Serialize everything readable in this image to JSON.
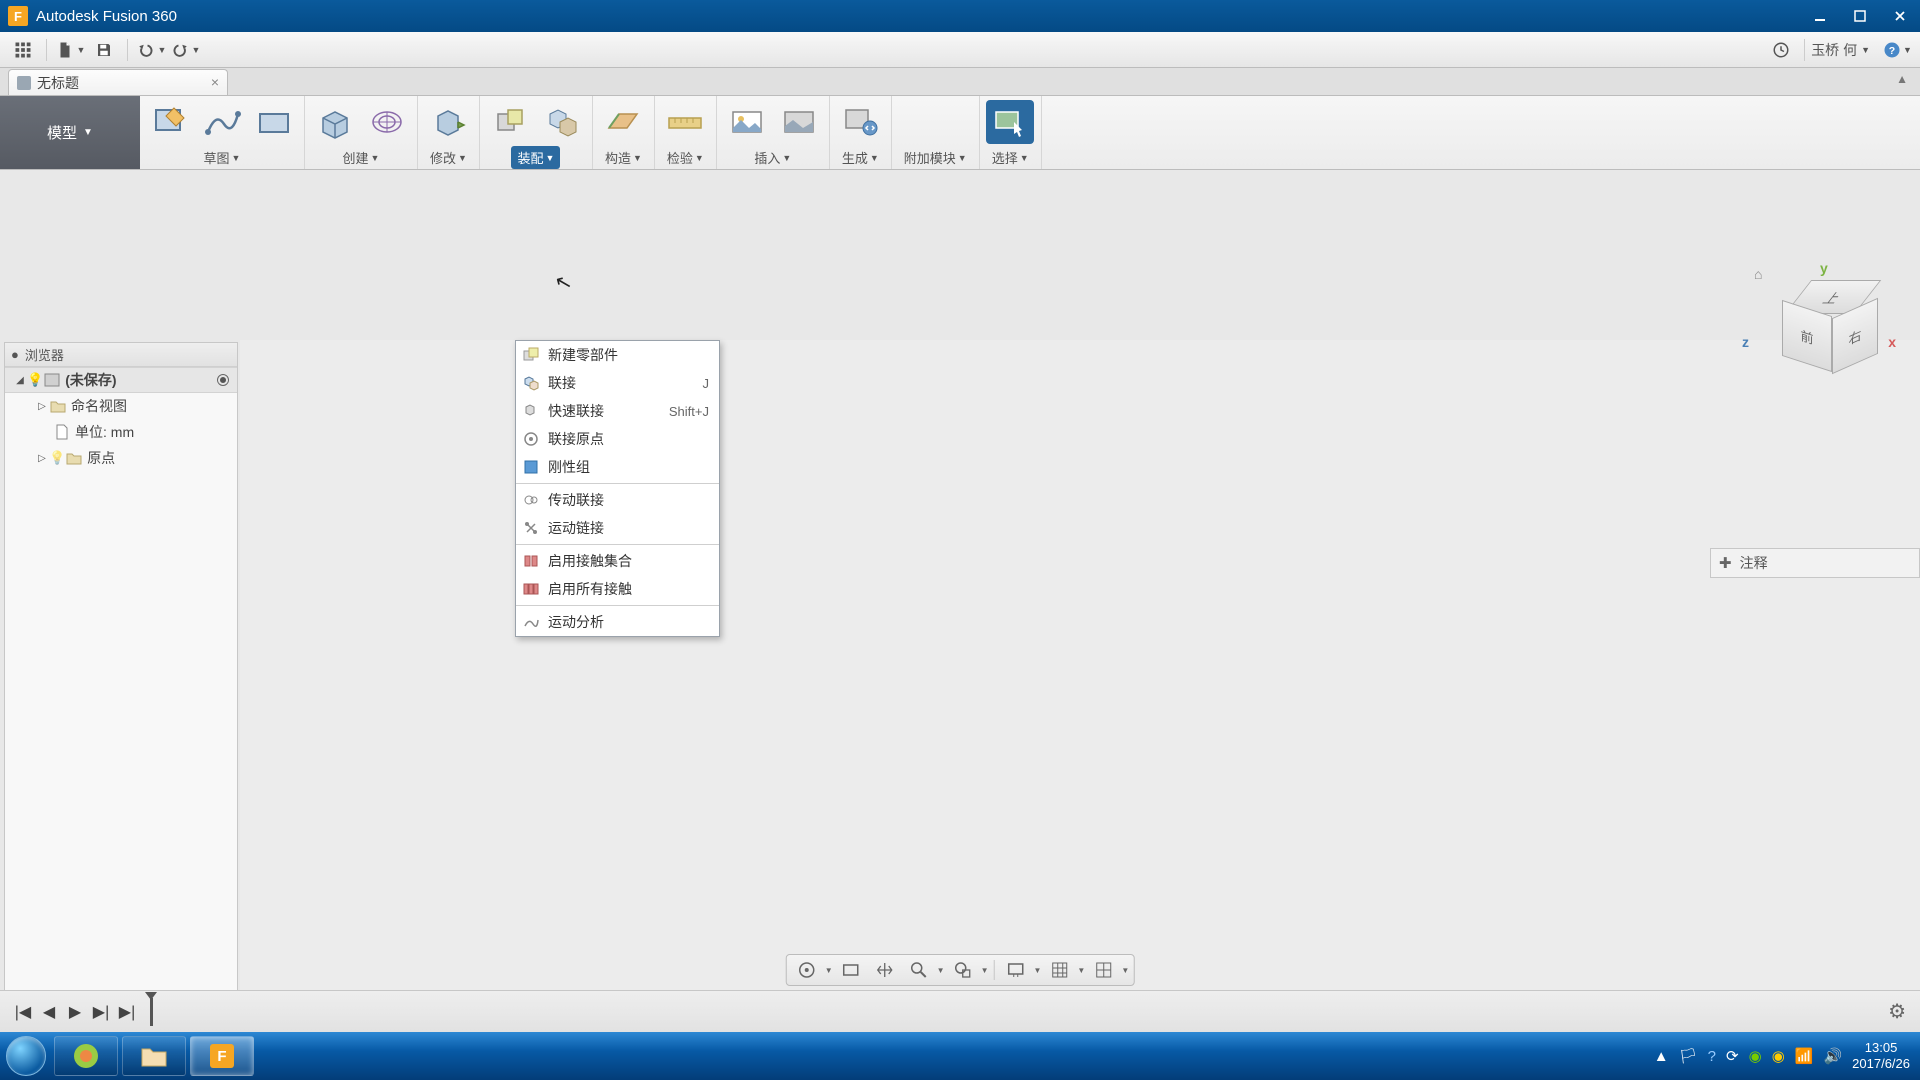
{
  "title": "Autodesk Fusion 360",
  "appInitial": "F",
  "user": "玉桥 何",
  "docTab": "无标题",
  "modeLabel": "模型",
  "ribbonGroups": [
    {
      "label": "草图"
    },
    {
      "label": "创建"
    },
    {
      "label": "修改"
    },
    {
      "label": "装配",
      "active": true
    },
    {
      "label": "构造"
    },
    {
      "label": "检验"
    },
    {
      "label": "插入"
    },
    {
      "label": "生成"
    },
    {
      "label": "附加模块"
    },
    {
      "label": "选择",
      "selected": true
    }
  ],
  "dropdown": [
    {
      "label": "新建零部件",
      "icon": "new-component"
    },
    {
      "label": "联接",
      "shortcut": "J",
      "icon": "joint"
    },
    {
      "label": "快速联接",
      "shortcut": "Shift+J",
      "icon": "as-built"
    },
    {
      "label": "联接原点",
      "icon": "joint-origin"
    },
    {
      "label": "刚性组",
      "icon": "rigid-group"
    },
    {
      "sep": true
    },
    {
      "label": "传动联接",
      "icon": "drive-joint"
    },
    {
      "label": "运动链接",
      "icon": "motion-link"
    },
    {
      "sep": true
    },
    {
      "label": "启用接触集合",
      "icon": "contact-set"
    },
    {
      "label": "启用所有接触",
      "icon": "contact-all"
    },
    {
      "sep": true
    },
    {
      "label": "运动分析",
      "icon": "motion-study"
    }
  ],
  "browserTitle": "浏览器",
  "browserRoot": "(未保存)",
  "browserItems": [
    {
      "label": "命名视图",
      "caret": true,
      "folder": true
    },
    {
      "label": "单位: mm",
      "doc": true
    },
    {
      "label": "原点",
      "caret": true,
      "bulb": true,
      "folder": true
    }
  ],
  "viewCube": {
    "top": "上",
    "front": "前",
    "right": "右",
    "y": "y",
    "x": "x",
    "z": "z"
  },
  "commentsLabel": "注释",
  "clock": {
    "time": "13:05",
    "date": "2017/6/26"
  }
}
